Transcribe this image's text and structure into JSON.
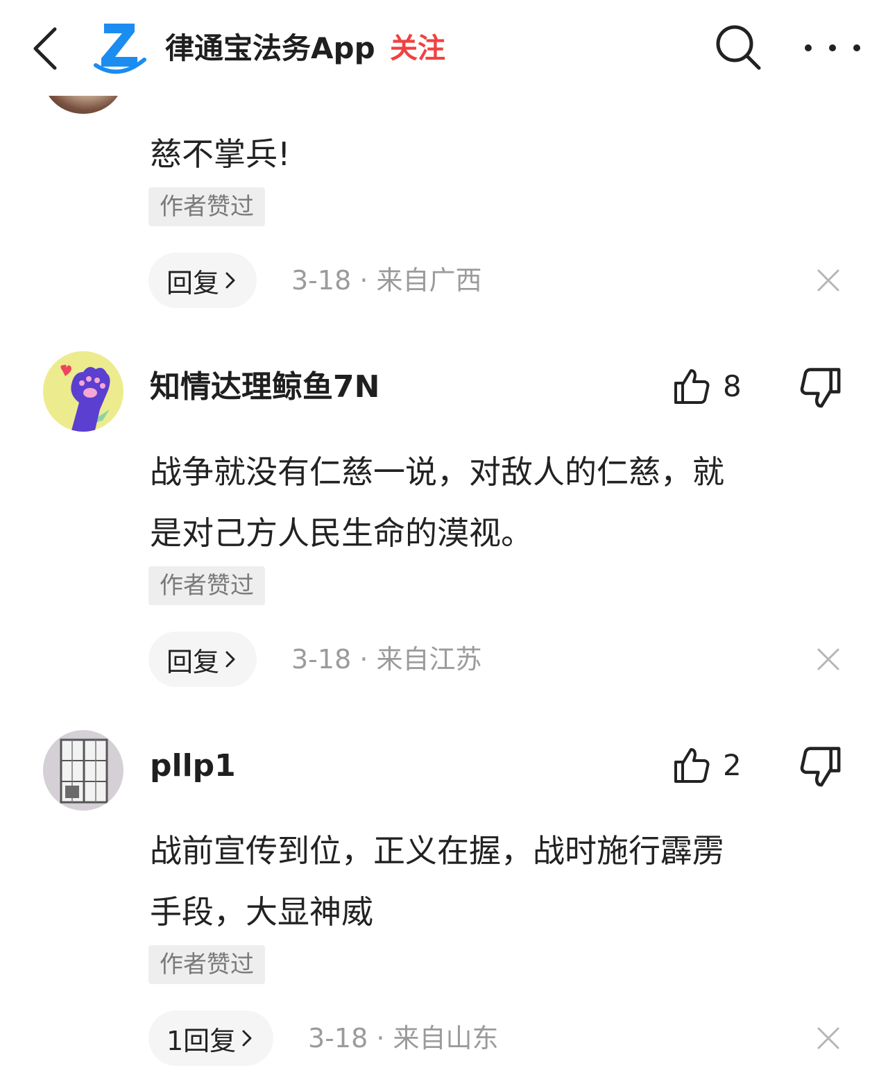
{
  "header": {
    "app_name": "律通宝法务App",
    "follow_label": "关注",
    "brand_color": "#1b8cf0",
    "follow_color": "#f04142",
    "icons": [
      "back-arrow-icon",
      "app-logo-icon",
      "search-icon",
      "more-icon"
    ]
  },
  "comments": [
    {
      "text_lines": [
        "慈不掌兵!"
      ],
      "badge": "作者赞过",
      "reply_label": "回复",
      "meta": "3-18 · 来自广西"
    },
    {
      "username": "知情达理鲸鱼7N",
      "likes": "8",
      "text_lines": [
        "战争就没有仁慈一说，对敌人的仁慈，就",
        "是对己方人民生命的漠视。"
      ],
      "badge": "作者赞过",
      "reply_label": "回复",
      "meta": "3-18 · 来自江苏"
    },
    {
      "username": "pllp1",
      "likes": "2",
      "text_lines": [
        "战前宣传到位，正义在握，战时施行霹雳",
        "手段，大显神威"
      ],
      "badge": "作者赞过",
      "reply_label": "1回复",
      "meta": "3-18 · 来自山东"
    }
  ]
}
